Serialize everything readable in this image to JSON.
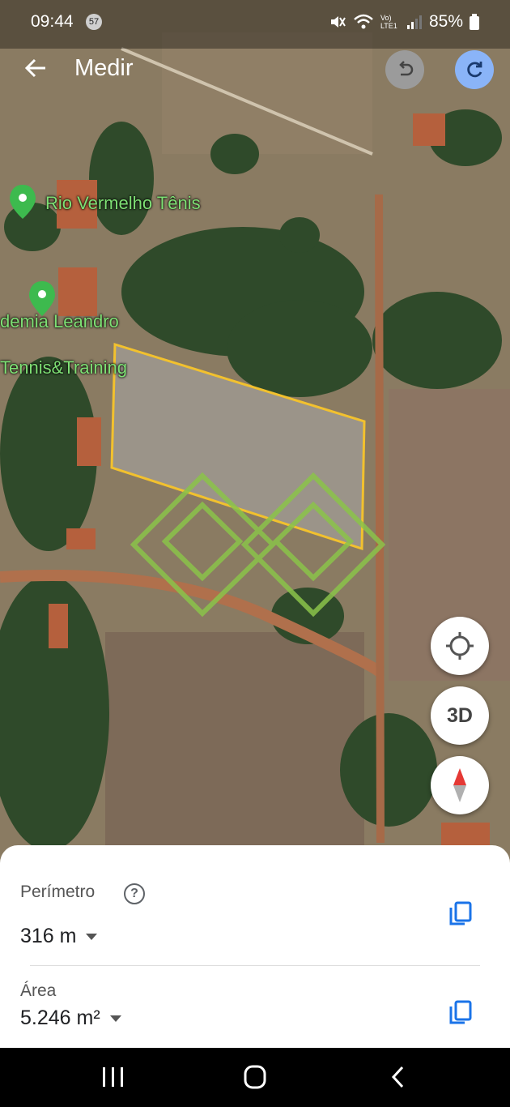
{
  "status_bar": {
    "time": "09:44",
    "notif_count": "57",
    "network": "Vo) LTE1",
    "battery": "85%"
  },
  "toolbar": {
    "title": "Medir"
  },
  "map": {
    "places": [
      {
        "name": "Rio Vermelho Tênis"
      },
      {
        "name_line1": "demia Leandro",
        "name_line2": "Tennis&Training"
      }
    ],
    "shape_color": "#f2c12e",
    "marker_color": "#8bc34a",
    "pin_color": "#3dba4e"
  },
  "map_controls": {
    "location": "my-location-icon",
    "three_d": "3D",
    "compass": "compass-icon"
  },
  "measurement": {
    "perimeter_label": "Perímetro",
    "perimeter_value": "316 m",
    "area_label": "Área",
    "area_value": "5.246 m²"
  },
  "navbar": {
    "items": [
      "recents-icon",
      "home-icon",
      "back-icon"
    ]
  }
}
